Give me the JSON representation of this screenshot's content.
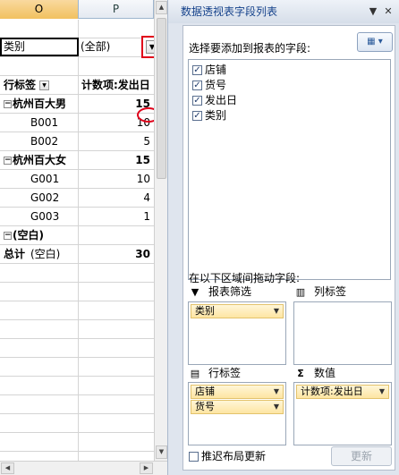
{
  "sheet": {
    "col_o": "O",
    "col_p": "P",
    "filter_label": "类别",
    "filter_value": "(全部)",
    "pivot_header_rows": "行标签",
    "pivot_header_values": "计数项:发出日",
    "rows": [
      {
        "label": "杭州百大男",
        "value": "15",
        "level": "group"
      },
      {
        "label": "B001",
        "value": "10",
        "level": "item"
      },
      {
        "label": "B002",
        "value": "5",
        "level": "item"
      },
      {
        "label": "杭州百大女",
        "value": "15",
        "level": "group"
      },
      {
        "label": "G001",
        "value": "10",
        "level": "item"
      },
      {
        "label": "G002",
        "value": "4",
        "level": "item"
      },
      {
        "label": "G003",
        "value": "1",
        "level": "item"
      },
      {
        "label": "(空白)",
        "value": "",
        "level": "group"
      },
      {
        "label": "(空白)",
        "value": "",
        "level": "item"
      }
    ],
    "total_label": "总计",
    "total_value": "30"
  },
  "pane": {
    "title": "数据透视表字段列表",
    "choose_label": "选择要添加到报表的字段:",
    "fields": [
      "店铺",
      "货号",
      "发出日",
      "类别"
    ],
    "drag_label": "在以下区域间拖动字段:",
    "areas": {
      "report_filter": {
        "title": "报表筛选",
        "items": [
          "类别"
        ]
      },
      "column_labels": {
        "title": "列标签",
        "items": []
      },
      "row_labels": {
        "title": "行标签",
        "items": [
          "店铺",
          "货号"
        ]
      },
      "values": {
        "title": "数值",
        "items": [
          "计数项:发出日"
        ]
      }
    },
    "defer_label": "推迟布局更新",
    "update_button": "更新"
  },
  "colors": {
    "highlight_red": "#e0001a",
    "chip_fill": "#fde5a2",
    "pane_bg": "#dfe5ee"
  }
}
